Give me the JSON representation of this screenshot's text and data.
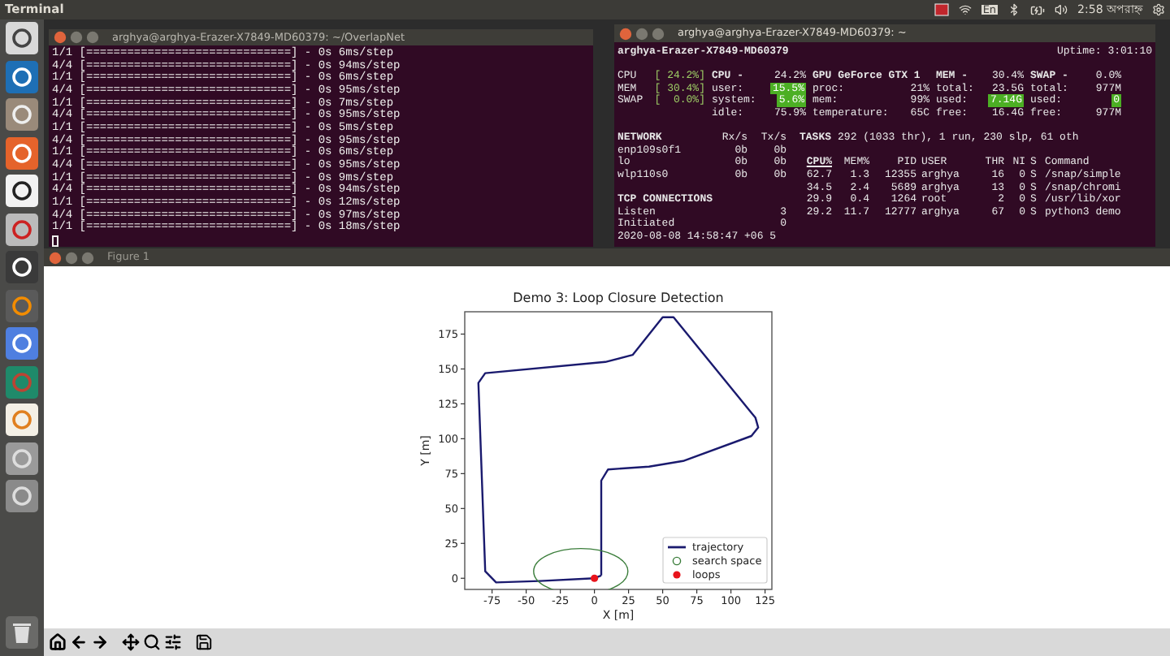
{
  "top_bar": {
    "app_title": "Terminal",
    "keyboard": "En",
    "clock": "2:58 অপরাহ্ন"
  },
  "left_terminal": {
    "title": "arghya@arghya-Erazer-X7849-MD60379: ~/OverlapNet",
    "lines": [
      "1/1 [==============================] - 0s 6ms/step",
      "4/4 [==============================] - 0s 94ms/step",
      "1/1 [==============================] - 0s 6ms/step",
      "4/4 [==============================] - 0s 95ms/step",
      "1/1 [==============================] - 0s 7ms/step",
      "4/4 [==============================] - 0s 95ms/step",
      "1/1 [==============================] - 0s 5ms/step",
      "4/4 [==============================] - 0s 95ms/step",
      "1/1 [==============================] - 0s 6ms/step",
      "4/4 [==============================] - 0s 95ms/step",
      "1/1 [==============================] - 0s 9ms/step",
      "4/4 [==============================] - 0s 94ms/step",
      "1/1 [==============================] - 0s 12ms/step",
      "4/4 [==============================] - 0s 97ms/step",
      "1/1 [==============================] - 0s 18ms/step"
    ]
  },
  "right_terminal": {
    "title": "arghya@arghya-Erazer-X7849-MD60379: ~",
    "hostname": "arghya-Erazer-X7849-MD60379",
    "uptime": "Uptime: 3:01:10",
    "quicklook": [
      {
        "label": "CPU",
        "value": "[ 24.2%]"
      },
      {
        "label": "MEM",
        "value": "[ 30.4%]"
      },
      {
        "label": "SWAP",
        "value": "[  0.0%]"
      }
    ],
    "blocks": [
      {
        "title": "CPU -",
        "value": "24.2%",
        "rows": [
          {
            "label": "user:",
            "value": "15.5%",
            "highlight": true
          },
          {
            "label": "system:",
            "value": "5.6%",
            "highlight": true
          },
          {
            "label": "idle:",
            "value": "75.9%",
            "highlight": false
          }
        ]
      },
      {
        "title": "GPU GeForce GTX 1",
        "rows": [
          {
            "label": "proc:",
            "value": "21%",
            "highlight": false
          },
          {
            "label": "mem:",
            "value": "99%",
            "highlight": false
          },
          {
            "label": "temperature:",
            "value": "65C",
            "highlight": false
          }
        ]
      },
      {
        "title": "MEM -",
        "value": "30.4%",
        "rows": [
          {
            "label": "total:",
            "value": "23.5G",
            "highlight": false
          },
          {
            "label": "used:",
            "value": "7.14G",
            "highlight": true
          },
          {
            "label": "free:",
            "value": "16.4G",
            "highlight": false
          }
        ]
      },
      {
        "title": "SWAP -",
        "value": "0.0%",
        "rows": [
          {
            "label": "total:",
            "value": "977M",
            "highlight": false
          },
          {
            "label": "used:",
            "value": "0",
            "highlight": true
          },
          {
            "label": "free:",
            "value": "977M",
            "highlight": false
          }
        ]
      }
    ],
    "network": {
      "title": "NETWORK",
      "rx": "Rx/s",
      "tx": "Tx/s",
      "rows": [
        {
          "name": "enp109s0f1",
          "rx": "0b",
          "tx": "0b"
        },
        {
          "name": "lo",
          "rx": "0b",
          "tx": "0b"
        },
        {
          "name": "wlp110s0",
          "rx": "0b",
          "tx": "0b"
        }
      ]
    },
    "tcp": {
      "title": "TCP CONNECTIONS",
      "rows": [
        {
          "label": "Listen",
          "value": "3"
        },
        {
          "label": "Initiated",
          "value": "0"
        }
      ]
    },
    "timestamp": "2020-08-08 14:58:47 +06 5",
    "tasks": {
      "label": "TASKS",
      "text": "292 (1033 thr), 1 run, 230 slp, 61 oth"
    },
    "process_columns": [
      {
        "label": "CPU%",
        "sorted": true
      },
      {
        "label": "MEM%",
        "sorted": false
      },
      {
        "label": "PID",
        "sorted": false
      },
      {
        "label": "USER",
        "sorted": false
      },
      {
        "label": "THR",
        "sorted": false
      },
      {
        "label": "NI",
        "sorted": false
      },
      {
        "label": "S",
        "sorted": false
      },
      {
        "label": "Command",
        "sorted": false
      }
    ],
    "processes": [
      [
        "62.7",
        "1.3",
        "12355",
        "arghya",
        "16",
        "0",
        "S",
        "/snap/simple"
      ],
      [
        "34.5",
        "2.4",
        "5689",
        "arghya",
        "13",
        "0",
        "S",
        "/snap/chromi"
      ],
      [
        "29.9",
        "0.4",
        "1264",
        "root",
        "2",
        "0",
        "S",
        "/usr/lib/xor"
      ],
      [
        "29.2",
        "11.7",
        "12777",
        "arghya",
        "67",
        "0",
        "S",
        "python3 demo"
      ]
    ]
  },
  "figure": {
    "title": "Figure 1",
    "plot": {
      "title": "Demo 3: Loop Closure Detection",
      "xlabel": "X [m]",
      "ylabel": "Y [m]",
      "xticks": [
        "-75",
        "-50",
        "-25",
        "0",
        "25",
        "50",
        "75",
        "100",
        "125"
      ],
      "yticks": [
        "175",
        "150",
        "125",
        "100",
        "75",
        "50",
        "25",
        "0"
      ],
      "legend": [
        {
          "label": "trajectory",
          "kind": "line",
          "color": "#1a1a6e"
        },
        {
          "label": "search space",
          "kind": "ring",
          "color": "#3a7d3a"
        },
        {
          "label": "loops",
          "kind": "dot",
          "color": "#e8141c"
        }
      ]
    }
  }
}
